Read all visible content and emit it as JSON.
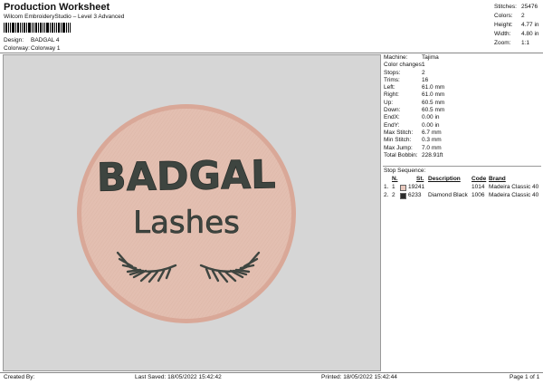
{
  "header": {
    "title": "Production Worksheet",
    "subtitle": "Wilcom EmbroideryStudio – Level 3 Advanced",
    "design_label": "Design:",
    "design_value": "BADGAL 4",
    "colorway_label": "Colorway:",
    "colorway_value": "Colorway 1"
  },
  "top_stats": [
    {
      "label": "Stitches:",
      "value": "25476"
    },
    {
      "label": "Colors:",
      "value": "2"
    },
    {
      "label": "Height:",
      "value": "4.77 in"
    },
    {
      "label": "Width:",
      "value": "4.80 in"
    },
    {
      "label": "Zoom:",
      "value": "1:1"
    }
  ],
  "design": {
    "line1": "BADGAL",
    "line2": "Lashes",
    "patch_color": "#e3bfb1",
    "rim_color": "#d9a898",
    "thread_color": "#3e4540"
  },
  "details": [
    {
      "label": "Machine:",
      "value": "Tajima"
    },
    {
      "label": "Color changes:",
      "value": "1"
    },
    {
      "label": "Stops:",
      "value": "2"
    },
    {
      "label": "Trims:",
      "value": "16"
    },
    {
      "label": "Left:",
      "value": "61.0 mm"
    },
    {
      "label": "Right:",
      "value": "61.0 mm"
    },
    {
      "label": "Up:",
      "value": "60.5 mm"
    },
    {
      "label": "Down:",
      "value": "60.5 mm"
    },
    {
      "label": "EndX:",
      "value": "0.00 in"
    },
    {
      "label": "EndY:",
      "value": "0.00 in"
    },
    {
      "label": "Max Stitch:",
      "value": "6.7 mm"
    },
    {
      "label": "Min Stitch:",
      "value": "0.3 mm"
    },
    {
      "label": "Max Jump:",
      "value": "7.0 mm"
    },
    {
      "label": "Total Bobbin:",
      "value": "228.91ft"
    }
  ],
  "stop_sequence": {
    "title": "Stop Sequence:",
    "headers": {
      "n": "N.",
      "st": "St.",
      "description": "Description",
      "code": "Code",
      "brand": "Brand"
    },
    "rows": [
      {
        "idx": "1.",
        "n": "1",
        "swatch": "#e8c8bd",
        "st": "19241",
        "description": "",
        "code": "1014",
        "brand": "Madeira Classic 40"
      },
      {
        "idx": "2.",
        "n": "2",
        "swatch": "#2b2b2b",
        "st": "6233",
        "description": "Diamond Black",
        "code": "1006",
        "brand": "Madeira Classic 40"
      }
    ]
  },
  "footer": {
    "created_by": "Created By:",
    "last_saved": "Last Saved: 18/05/2022 15:42:42",
    "printed": "Printed: 18/05/2022 15:42:44",
    "page": "Page 1 of 1"
  }
}
